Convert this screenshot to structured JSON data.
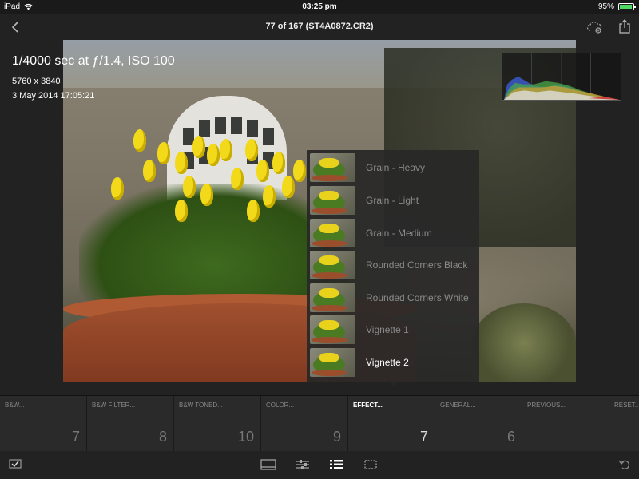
{
  "status": {
    "device": "iPad",
    "time": "03:25 pm",
    "battery": "95%"
  },
  "header": {
    "title": "77 of 167 (ST4A0872.CR2)"
  },
  "exif": {
    "exposure": "1/4000 sec at ƒ/1.4, ISO 100",
    "dimensions": "5760 x 3840",
    "date": "3 May 2014 17:05:21"
  },
  "presets": [
    {
      "label": "Grain - Heavy"
    },
    {
      "label": "Grain - Light"
    },
    {
      "label": "Grain - Medium"
    },
    {
      "label": "Rounded Corners Black"
    },
    {
      "label": "Rounded Corners White"
    },
    {
      "label": "Vignette 1"
    },
    {
      "label": "Vignette 2"
    }
  ],
  "categories": [
    {
      "name": "B&W...",
      "count": "7"
    },
    {
      "name": "B&W FILTER...",
      "count": "8"
    },
    {
      "name": "B&W TONED...",
      "count": "10"
    },
    {
      "name": "COLOR...",
      "count": "9"
    },
    {
      "name": "EFFECT...",
      "count": "7"
    },
    {
      "name": "GENERAL...",
      "count": "6"
    },
    {
      "name": "PREVIOUS...",
      "count": ""
    },
    {
      "name": "RESET...",
      "count": ""
    }
  ],
  "colors": {
    "accent": "#ffffff",
    "battery": "#4cd964",
    "background": "#222222"
  }
}
